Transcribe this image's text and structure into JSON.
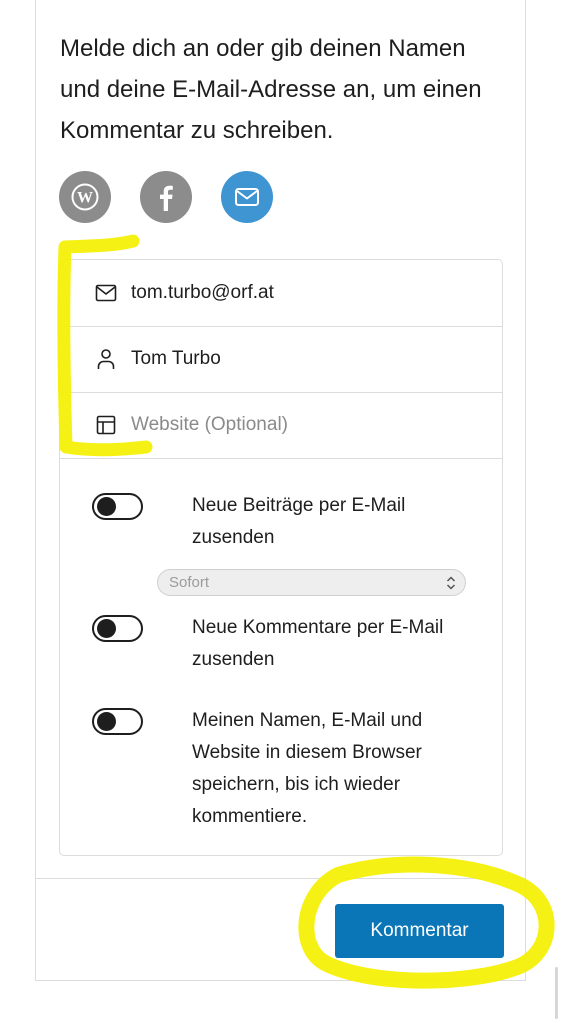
{
  "intro": {
    "text": "Melde dich an oder gib deinen Namen und deine E-Mail-Adresse an, um einen Kommentar zu schreiben."
  },
  "social_buttons": [
    {
      "icon": "wordpress-icon",
      "color": "#8c8c8c"
    },
    {
      "icon": "facebook-icon",
      "color": "#8c8c8c"
    },
    {
      "icon": "mail-icon",
      "color": "#3e95d2"
    }
  ],
  "form": {
    "email": {
      "value": "tom.turbo@orf.at",
      "icon": "mail-icon"
    },
    "name": {
      "value": "Tom Turbo",
      "icon": "person-icon"
    },
    "website": {
      "placeholder": "Website (Optional)",
      "icon": "layout-icon"
    }
  },
  "options": {
    "posts_toggle": {
      "label": "Neue Beiträge per E-Mail zusenden",
      "on": false
    },
    "frequency_select": {
      "selected": "Sofort"
    },
    "comments_toggle": {
      "label": "Neue Kommentare per E-Mail zusenden",
      "on": false
    },
    "save_toggle": {
      "label": "Meinen Namen, E-Mail und Website in diesem Browser speichern, bis ich wieder kommentiere.",
      "on": false
    }
  },
  "submit": {
    "label": "Kommentar",
    "color": "#0a76b7"
  },
  "annotation_color": "#f5f000"
}
